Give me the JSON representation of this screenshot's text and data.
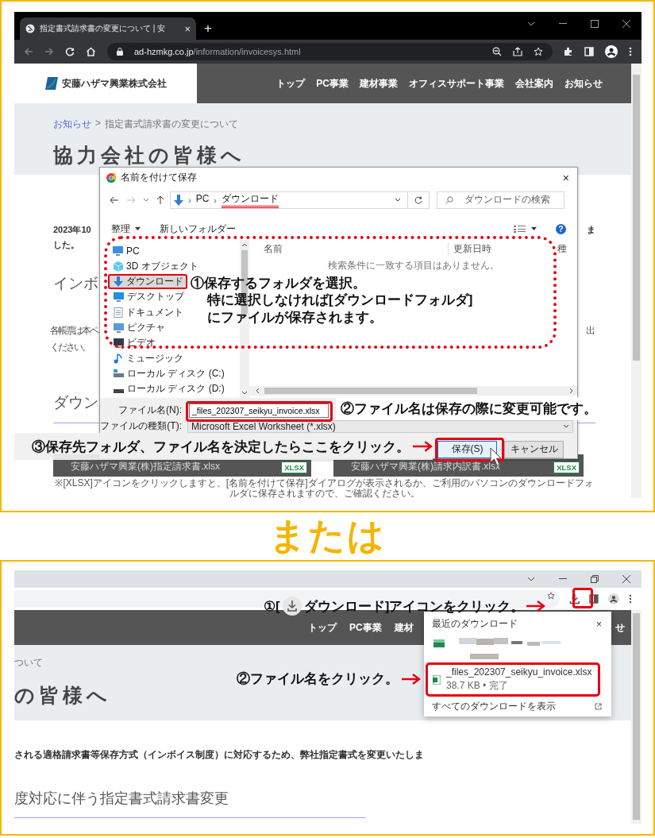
{
  "panel_1": {
    "browser": {
      "tab": {
        "title": "指定書式請求書の変更について | 安",
        "close": "×"
      },
      "new_tab": "+",
      "address": {
        "domain": "ad-hzmkg.co.jp",
        "path": "/information/invoicesys.html"
      }
    },
    "site": {
      "logo": "安藤ハザマ興業株式会社",
      "nav": [
        "トップ",
        "PC事業",
        "建材事業",
        "オフィスサポート事業",
        "会社案内",
        "お知らせ"
      ],
      "breadcrumb": {
        "link": "お知らせ",
        "separator": ">",
        "current": "指定書式請求書の変更について"
      },
      "heading": "協力会社の皆様へ",
      "intro": {
        "left": [
          "2023年10",
          "した。"
        ],
        "right": "ま"
      },
      "section_heading": "インボ",
      "body": {
        "left": [
          "各帳票は本ペ",
          "ください。"
        ],
        "right": "出"
      },
      "download_heading": "ダウン",
      "downloads": [
        {
          "label": "安藤ハザマ興業(株)指定請求書.xlsx",
          "badge": "XLSX"
        },
        {
          "label": "安藤ハザマ興業(株)請求内訳書.xlsx",
          "badge": "XLSX"
        }
      ],
      "note": "※[XLSX]アイコンをクリックしますと、[名前を付けて保存]ダイアログが表示されるか、ご利用のパソコンのダウンロードフォルダに保存されますので、ご確認ください。"
    },
    "dialog": {
      "title": "名前を付けて保存",
      "close": "×",
      "path_separator": "›",
      "path": [
        {
          "label": "PC",
          "highlighted": false
        },
        {
          "label": "ダウンロード",
          "highlighted": true
        }
      ],
      "search": {
        "placeholder": "ダウンロードの検索"
      },
      "toolbar": {
        "organize": "整理",
        "new_folder": "新しいフォルダー",
        "help": "?"
      },
      "nav": [
        {
          "label": "PC",
          "kind": "pc",
          "selected": false,
          "highlighted": false
        },
        {
          "label": "3D オブジェクト",
          "kind": "objects",
          "selected": false,
          "highlighted": false
        },
        {
          "label": "ダウンロード",
          "kind": "download",
          "selected": true,
          "highlighted": true
        },
        {
          "label": "デスクトップ",
          "kind": "desktop",
          "selected": false,
          "highlighted": false
        },
        {
          "label": "ドキュメント",
          "kind": "documents",
          "selected": false,
          "highlighted": false
        },
        {
          "label": "ピクチャ",
          "kind": "pictures",
          "selected": false,
          "highlighted": false
        },
        {
          "label": "ビデオ",
          "kind": "videos",
          "selected": false,
          "highlighted": false
        },
        {
          "label": "ミュージック",
          "kind": "music",
          "selected": false,
          "highlighted": false
        },
        {
          "label": "ローカル ディスク (C:)",
          "kind": "system_drive",
          "selected": false,
          "highlighted": false
        },
        {
          "label": "ローカル ディスク (D:)",
          "kind": "drive",
          "selected": false,
          "highlighted": false
        }
      ],
      "columns": [
        "名前",
        "更新日時",
        "種"
      ],
      "empty_message": "検索条件に一致する項目はありません。",
      "file_name": {
        "label": "ファイル名(N):",
        "value": "_files_202307_seikyu_invoice.xlsx",
        "highlighted": true
      },
      "file_type": {
        "label": "ファイルの種類(T):",
        "value": "Microsoft Excel Worksheet (*.xlsx)"
      },
      "buttons": [
        {
          "label": "保存(S)",
          "kind": "primary",
          "highlighted": true
        },
        {
          "label": "キャンセル",
          "kind": "secondary",
          "highlighted": false
        }
      ]
    },
    "callouts": [
      {
        "lines": [
          "①保存するフォルダを選択。",
          "特に選択しなければ[ダウンロードフォルダ]",
          "にファイルが保存されます。"
        ]
      },
      {
        "lines": [
          "②ファイル名は保存の際に変更可能です。"
        ]
      },
      {
        "lines": [
          "③保存先フォルダ、ファイル名を決定したらここをクリック。"
        ]
      }
    ]
  },
  "divider_text": "または",
  "panel_2": {
    "site": {
      "nav": [
        "トップ",
        "PC事業",
        "建材"
      ],
      "nav_end": "せ",
      "breadcrumb": "ついて",
      "heading": "の皆様へ",
      "text": "される適格請求書等保存方式（インボイス制度）に対応するため、弊社指定書式を変更いたしま",
      "section_heading": "度対応に伴う指定書式請求書変更"
    },
    "download_button": {
      "highlighted": true
    },
    "downloads_popup": {
      "title": "最近のダウンロード",
      "close": "×",
      "items": [
        {
          "kind": "blurred"
        },
        {
          "kind": "file",
          "name": "_files_202307_seikyu_invoice.xlsx",
          "status": "38.7 KB • 完了",
          "highlighted": true
        }
      ],
      "show_all": "すべてのダウンロードを表示"
    },
    "callouts": [
      {
        "parts": [
          "①[",
          "ダウンロード]アイコンをクリック。"
        ]
      },
      {
        "parts": [
          "②ファイル名をクリック。"
        ]
      }
    ]
  }
}
